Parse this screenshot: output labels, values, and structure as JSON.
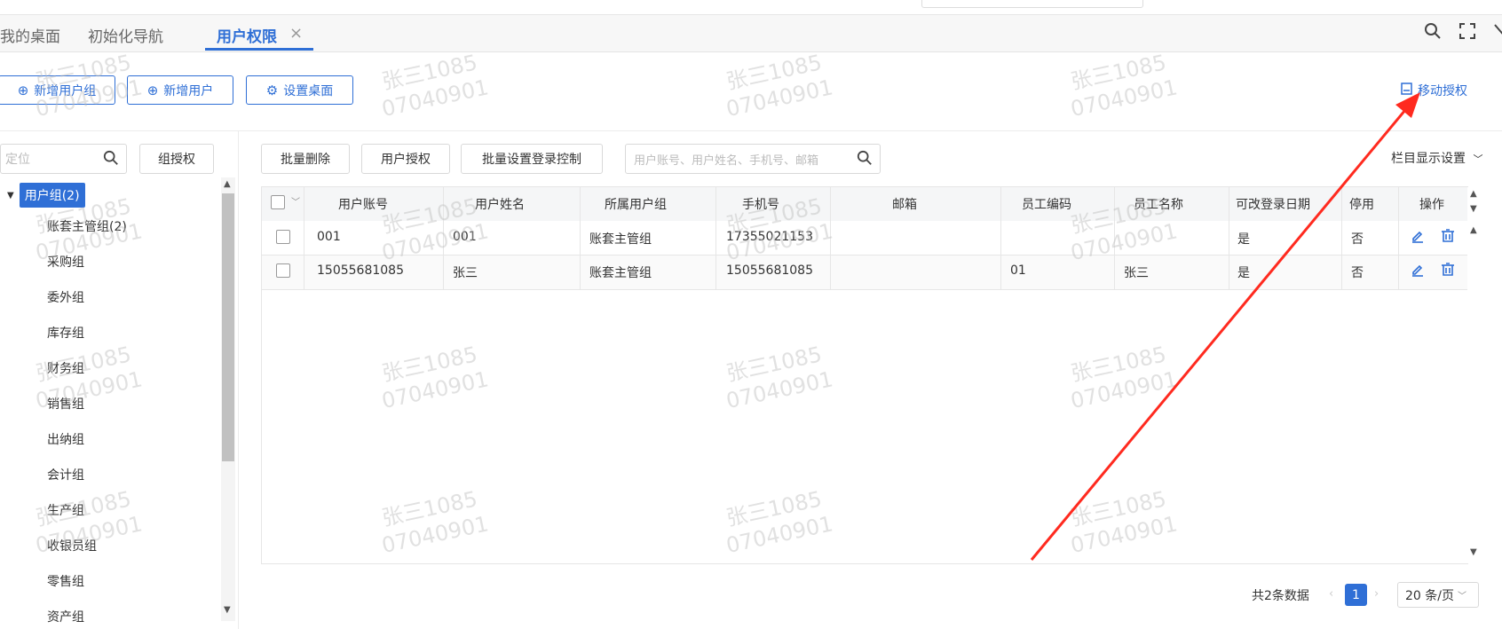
{
  "tabs": {
    "items": [
      {
        "label": "我的桌面"
      },
      {
        "label": "初始化导航"
      },
      {
        "label": "用户权限"
      }
    ],
    "close_glyph": "×"
  },
  "toolbar_icons": [
    "search-icon",
    "fullscreen-icon",
    "close-icon"
  ],
  "actions": {
    "add_group": "新增用户组",
    "add_user": "新增用户",
    "set_desktop": "设置桌面",
    "move_auth": "移动授权"
  },
  "left": {
    "locate_placeholder": "定位",
    "group_auth": "组授权",
    "root": "用户组(2)",
    "groups": [
      "账套主管组(2)",
      "采购组",
      "委外组",
      "库存组",
      "财务组",
      "销售组",
      "出纳组",
      "会计组",
      "生产组",
      "收银员组",
      "零售组",
      "资产组"
    ]
  },
  "right": {
    "batch_delete": "批量删除",
    "user_auth": "用户授权",
    "batch_login": "批量设置登录控制",
    "search_placeholder": "用户账号、用户姓名、手机号、邮箱",
    "column_settings": "栏目显示设置"
  },
  "table": {
    "columns": [
      "用户账号",
      "用户姓名",
      "所属用户组",
      "手机号",
      "邮箱",
      "员工编码",
      "员工名称",
      "可改登录日期",
      "停用",
      "操作"
    ],
    "rows": [
      {
        "account": "001",
        "name": "001",
        "group": "账套主管组",
        "phone": "17355021153",
        "email": "",
        "emp_code": "",
        "emp_name": "",
        "can_change_date": "是",
        "disabled": "否"
      },
      {
        "account": "15055681085",
        "name": "张三",
        "group": "账套主管组",
        "phone": "15055681085",
        "email": "",
        "emp_code": "01",
        "emp_name": "张三",
        "can_change_date": "是",
        "disabled": "否"
      }
    ]
  },
  "pagination": {
    "total": "共2条数据",
    "current": "1",
    "page_size": "20 条/页"
  },
  "watermark": {
    "line1": "张三1085",
    "line2": "07040901"
  },
  "colors": {
    "accent": "#2f6fd6",
    "arrow": "#ff2a1f"
  }
}
